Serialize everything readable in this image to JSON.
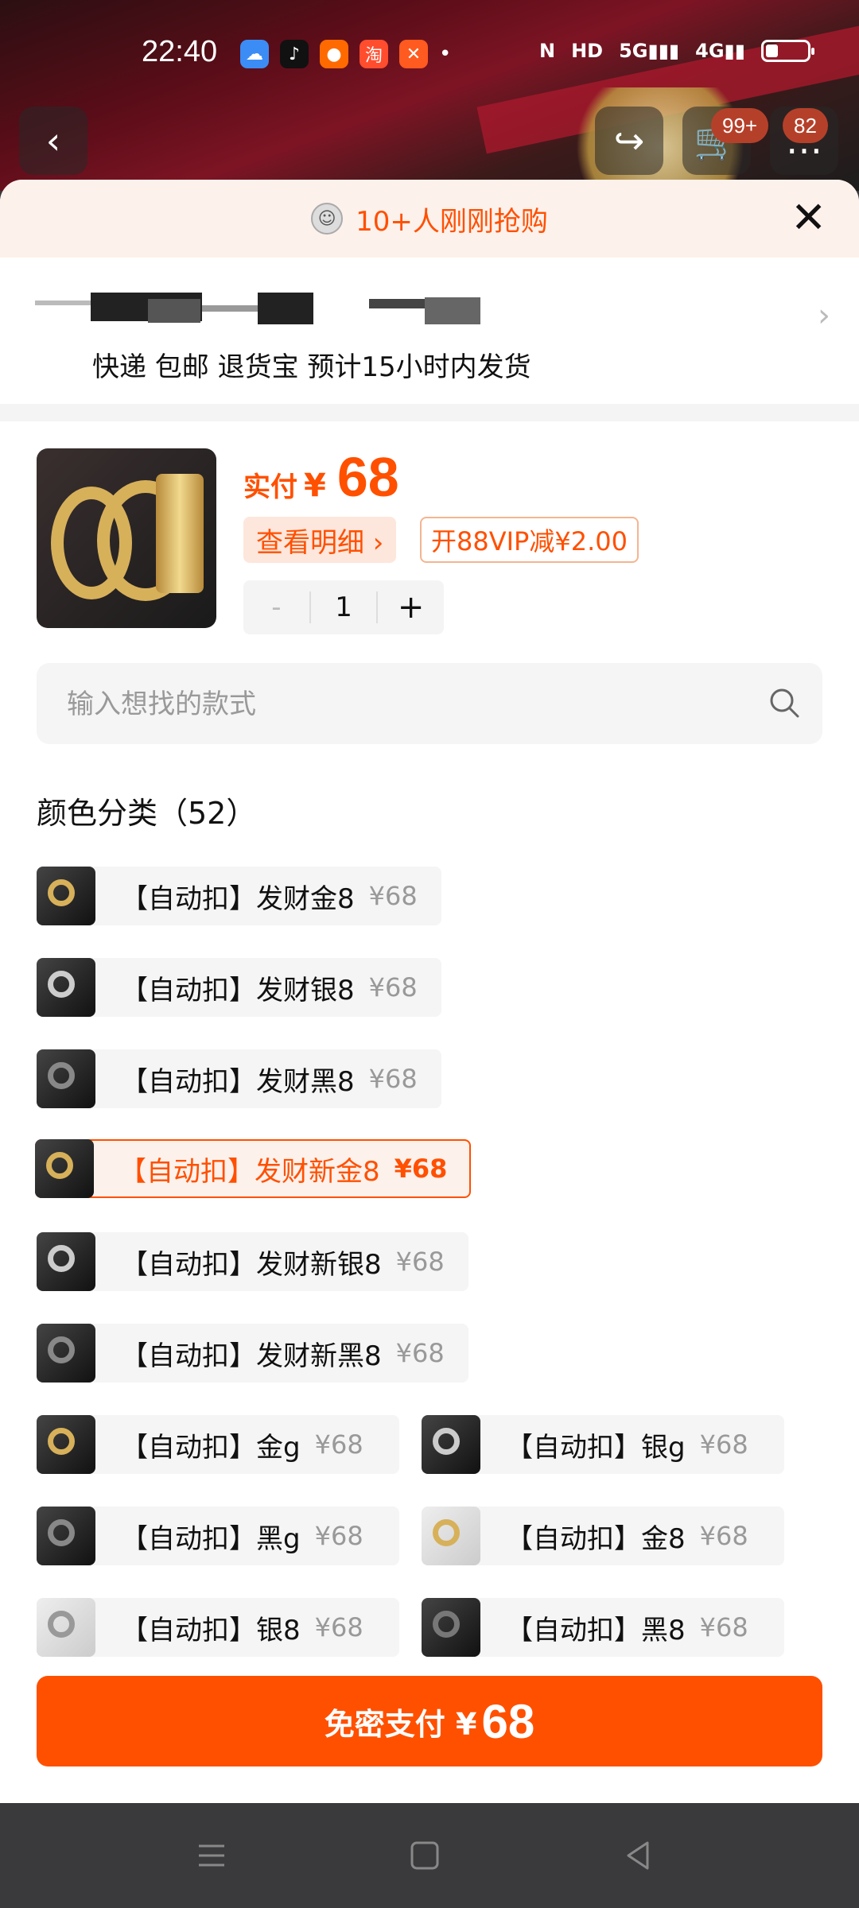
{
  "status_bar": {
    "time": "22:40",
    "icons": [
      "weather-icon",
      "tiktok-icon",
      "app-icon",
      "taobao-icon",
      "fitness-icon"
    ],
    "network": [
      "N",
      "HD",
      "5G",
      "4G"
    ],
    "battery_level": 0.3
  },
  "top_nav": {
    "cart_badge": "99+",
    "msg_badge": "82"
  },
  "banner": {
    "text": "10+人刚刚抢购"
  },
  "address": {
    "delivery_line": "快递 包邮 退货宝 预计15小时内发货"
  },
  "product": {
    "price_label": "实付",
    "currency": "¥",
    "price": "68",
    "detail_button": "查看明细 ›",
    "vip_text": "开88VIP减¥2.00",
    "qty_minus": "-",
    "quantity": "1",
    "qty_plus": "+"
  },
  "search": {
    "placeholder": "输入想找的款式"
  },
  "category": {
    "title": "颜色分类（52）",
    "options": [
      {
        "name": "【自动扣】发财金8",
        "price": "¥68",
        "selected": false
      },
      {
        "name": "【自动扣】发财银8",
        "price": "¥68",
        "selected": false
      },
      {
        "name": "【自动扣】发财黑8",
        "price": "¥68",
        "selected": false
      },
      {
        "name": "【自动扣】发财新金8",
        "price": "¥68",
        "selected": true
      },
      {
        "name": "【自动扣】发财新银8",
        "price": "¥68",
        "selected": false
      },
      {
        "name": "【自动扣】发财新黑8",
        "price": "¥68",
        "selected": false
      },
      {
        "name": "【自动扣】金g",
        "price": "¥68",
        "selected": false
      },
      {
        "name": "【自动扣】银g",
        "price": "¥68",
        "selected": false
      },
      {
        "name": "【自动扣】黑g",
        "price": "¥68",
        "selected": false
      },
      {
        "name": "【自动扣】金8",
        "price": "¥68",
        "selected": false
      },
      {
        "name": "【自动扣】银8",
        "price": "¥68",
        "selected": false
      },
      {
        "name": "【自动扣】黑8",
        "price": "¥68",
        "selected": false
      }
    ]
  },
  "pay_button": {
    "label": "免密支付 ¥",
    "amount": "68"
  },
  "colors": {
    "accent": "#ff5000",
    "accent_light": "#fdf1ec",
    "sheet_bg": "#ffffff"
  }
}
